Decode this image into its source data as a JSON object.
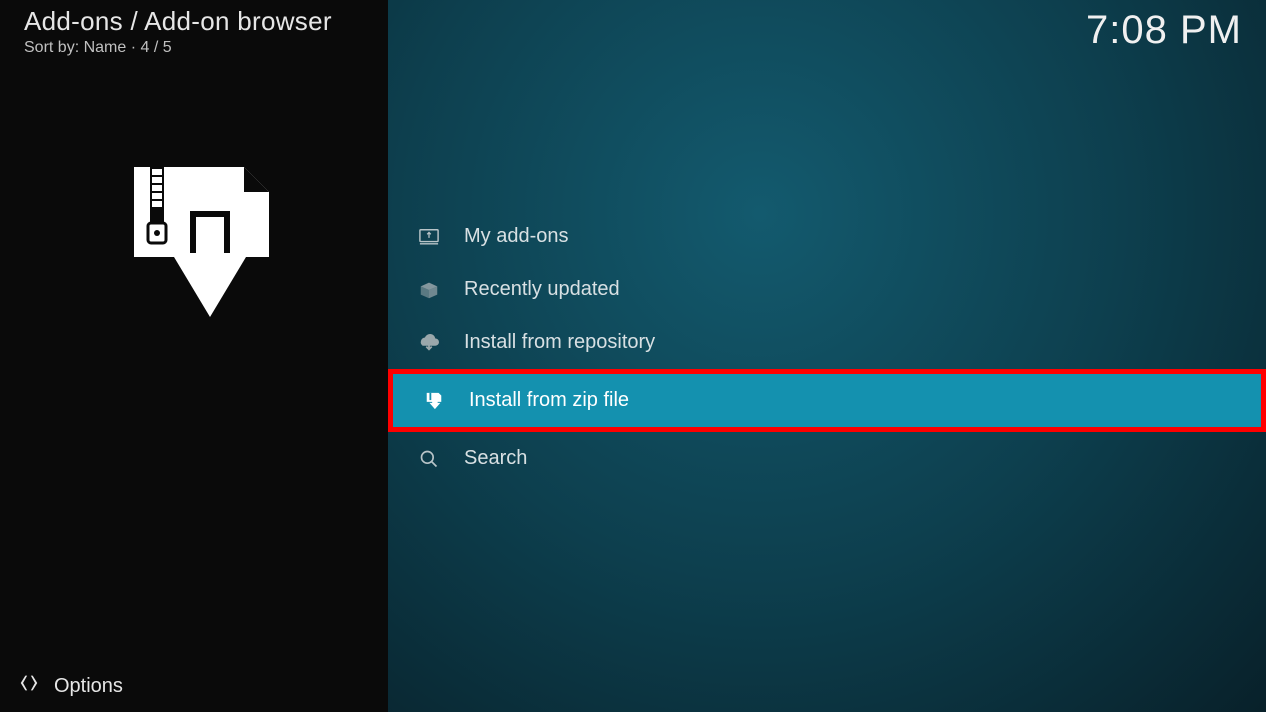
{
  "header": {
    "breadcrumb": "Add-ons / Add-on browser",
    "sort_prefix": "Sort by:",
    "sort_value": "Name",
    "position": "4 / 5"
  },
  "clock": "7:08 PM",
  "menu": {
    "items": [
      {
        "label": "My add-ons",
        "icon": "monitor-addon-icon",
        "selected": false
      },
      {
        "label": "Recently updated",
        "icon": "open-box-icon",
        "selected": false
      },
      {
        "label": "Install from repository",
        "icon": "cloud-download-icon",
        "selected": false
      },
      {
        "label": "Install from zip file",
        "icon": "zip-download-icon",
        "selected": true
      },
      {
        "label": "Search",
        "icon": "search-icon",
        "selected": false
      }
    ]
  },
  "footer": {
    "options_label": "Options"
  }
}
